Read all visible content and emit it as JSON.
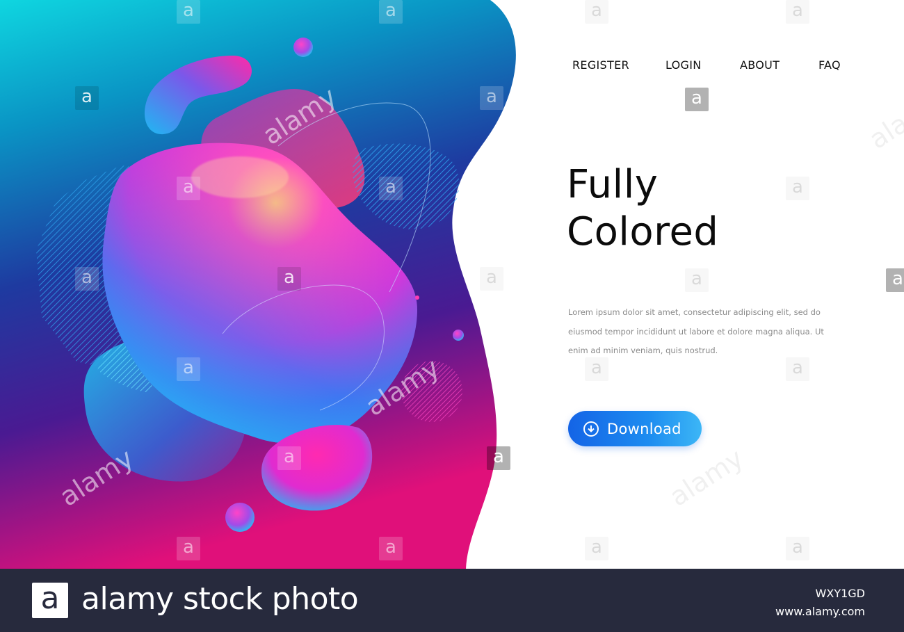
{
  "nav": {
    "items": [
      {
        "label": "REGISTER"
      },
      {
        "label": "LOGIN"
      },
      {
        "label": "ABOUT"
      },
      {
        "label": "FAQ"
      }
    ]
  },
  "hero": {
    "title_line1": "Fully",
    "title_line2": "Colored",
    "body_line1": "Lorem ipsum dolor sit amet, consectetur adipiscing elit, sed do",
    "body_line2": "eiusmod tempor incididunt ut labore et dolore magna aliqua. Ut",
    "body_line3": "enim ad minim veniam, quis nostrud.",
    "button_label": "Download",
    "button_icon": "download-circle-icon"
  },
  "watermark": {
    "letter": "a",
    "word": "alamy"
  },
  "stock": {
    "logo_letter": "a",
    "brand": "alamy stock photo",
    "image_id": "WXY1GD",
    "url": "www.alamy.com"
  },
  "colors": {
    "gradient_top": "#0fd6e0",
    "gradient_mid": "#1e3aa0",
    "gradient_bottom": "#e0107a",
    "blob_pink": "#ff2aa8",
    "blob_blue": "#1fb4f0",
    "button_blue": "#1464e6",
    "stock_bar": "#272a3d"
  }
}
